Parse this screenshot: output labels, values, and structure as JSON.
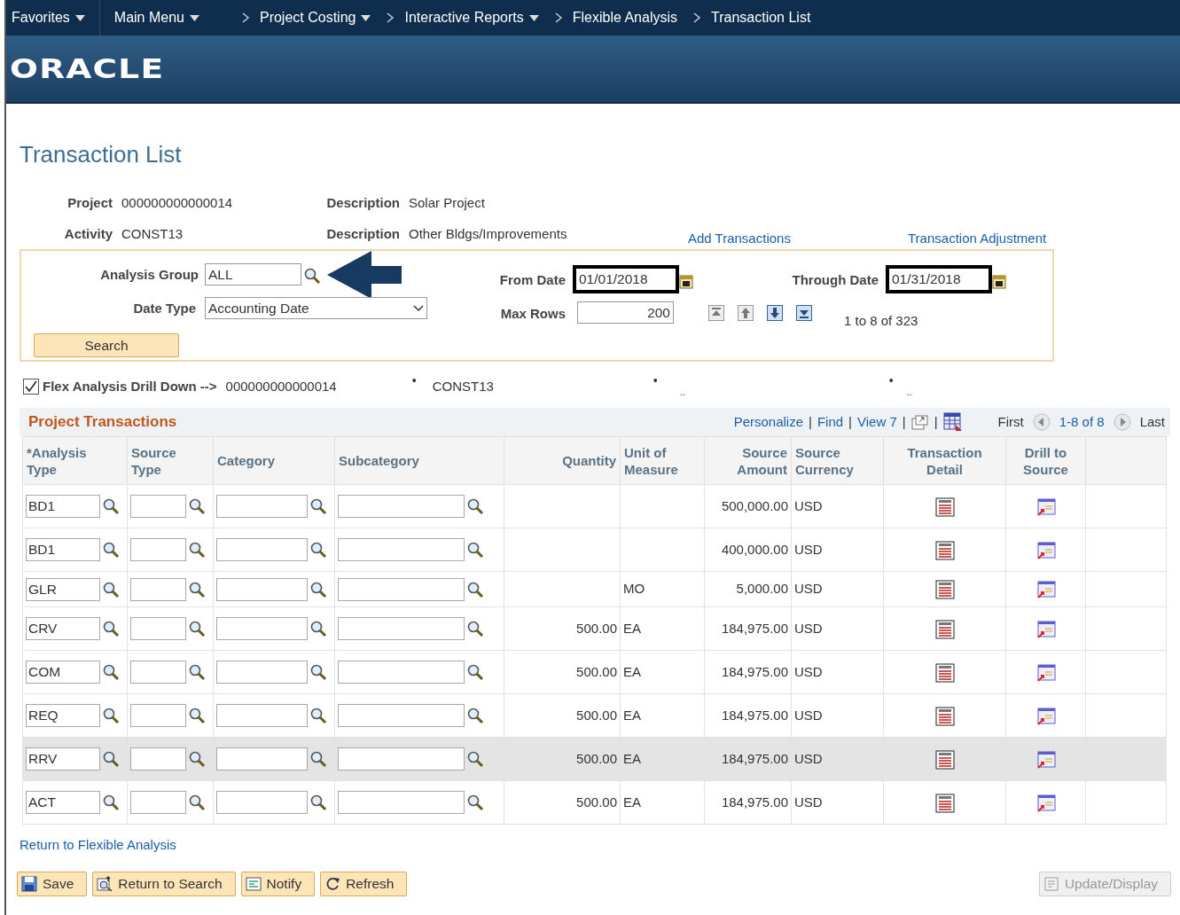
{
  "breadcrumbs": [
    {
      "label": "Favorites",
      "dropdown": true,
      "separator": false
    },
    {
      "label": "Main Menu",
      "dropdown": true,
      "separator": false
    },
    {
      "label": "Project Costing",
      "dropdown": true,
      "separator": true
    },
    {
      "label": "Interactive Reports",
      "dropdown": true,
      "separator": true
    },
    {
      "label": "Flexible Analysis",
      "dropdown": false,
      "separator": true
    },
    {
      "label": "Transaction List",
      "dropdown": false,
      "separator": true
    }
  ],
  "logo": "ORACLE",
  "page_title": "Transaction List",
  "header_fields": [
    {
      "label": "Project",
      "value": "000000000000014"
    },
    {
      "label": "Description",
      "value": "Solar Project"
    },
    {
      "label": "Activity",
      "value": "CONST13"
    },
    {
      "label": "Description",
      "value": "Other Bldgs/Improvements"
    }
  ],
  "header_links": [
    "Add Transactions",
    "Transaction Adjustment"
  ],
  "search": {
    "analysis_group": {
      "label": "Analysis Group",
      "value": "ALL"
    },
    "date_type": {
      "label": "Date Type",
      "value": "Accounting Date"
    },
    "button": "Search",
    "from_date": {
      "label": "From Date",
      "value": "01/01/2018",
      "outlined": true
    },
    "through_date": {
      "label": "Through Date",
      "value": "01/31/2018",
      "outlined": true
    },
    "max_rows": {
      "label": "Max Rows",
      "value": "200"
    },
    "count": "1 to 8 of 323"
  },
  "drill_down": {
    "checked": true,
    "label": "Flex Analysis Drill Down -->",
    "parts": [
      {
        "kind": "value",
        "text": "000000000000014"
      },
      {
        "kind": "bullet",
        "text": "•"
      },
      {
        "kind": "value",
        "text": "CONST13"
      },
      {
        "kind": "bullet",
        "text": "•"
      },
      {
        "kind": "dots",
        "text": ".."
      },
      {
        "kind": "bullet",
        "text": "•"
      },
      {
        "kind": "dots",
        "text": ".."
      }
    ]
  },
  "grid": {
    "title": "Project Transactions",
    "toolbar": [
      {
        "kind": "link",
        "text": "Personalize"
      },
      {
        "kind": "separator",
        "text": "|"
      },
      {
        "kind": "link",
        "text": "Find"
      },
      {
        "kind": "separator",
        "text": "|"
      },
      {
        "kind": "link",
        "text": "View 7"
      },
      {
        "kind": "separator",
        "text": "|"
      },
      {
        "kind": "new_window"
      },
      {
        "kind": "separator",
        "text": "|"
      },
      {
        "kind": "spreadsheet"
      }
    ],
    "first": "First",
    "range": "1-8 of 8",
    "last": "Last",
    "columns": [
      "*Analysis Type",
      "Source Type",
      "Category",
      "Subcategory",
      "Quantity",
      "Unit of Measure",
      "Source Amount",
      "Source Currency",
      "Transaction Detail",
      "Drill to Source"
    ],
    "rows": [
      {
        "analysis_type": "BD1",
        "source_amount": "500,000.00",
        "currency": "USD",
        "highlighted": false
      },
      {
        "analysis_type": "BD1",
        "source_amount": "400,000.00",
        "currency": "USD",
        "highlighted": false
      },
      {
        "analysis_type": "GLR",
        "unit": "MO",
        "source_amount": "5,000.00",
        "currency": "USD",
        "highlighted": false
      },
      {
        "analysis_type": "CRV",
        "quantity": "500.00",
        "unit": "EA",
        "source_amount": "184,975.00",
        "currency": "USD",
        "highlighted": false
      },
      {
        "analysis_type": "COM",
        "quantity": "500.00",
        "unit": "EA",
        "source_amount": "184,975.00",
        "currency": "USD",
        "highlighted": false
      },
      {
        "analysis_type": "REQ",
        "quantity": "500.00",
        "unit": "EA",
        "source_amount": "184,975.00",
        "currency": "USD",
        "highlighted": false
      },
      {
        "analysis_type": "RRV",
        "quantity": "500.00",
        "unit": "EA",
        "source_amount": "184,975.00",
        "currency": "USD",
        "highlighted": true
      },
      {
        "analysis_type": "ACT",
        "quantity": "500.00",
        "unit": "EA",
        "source_amount": "184,975.00",
        "currency": "USD",
        "highlighted": false
      }
    ]
  },
  "footer_link": "Return to Flexible Analysis",
  "buttons": [
    {
      "kind": "save",
      "label": "Save",
      "disabled": false
    },
    {
      "kind": "return",
      "label": "Return to Search",
      "disabled": false
    },
    {
      "kind": "notify",
      "label": "Notify",
      "disabled": false
    },
    {
      "kind": "refresh",
      "label": "Refresh",
      "disabled": false
    },
    {
      "kind": "update",
      "label": "Update/Display",
      "disabled": true
    }
  ]
}
